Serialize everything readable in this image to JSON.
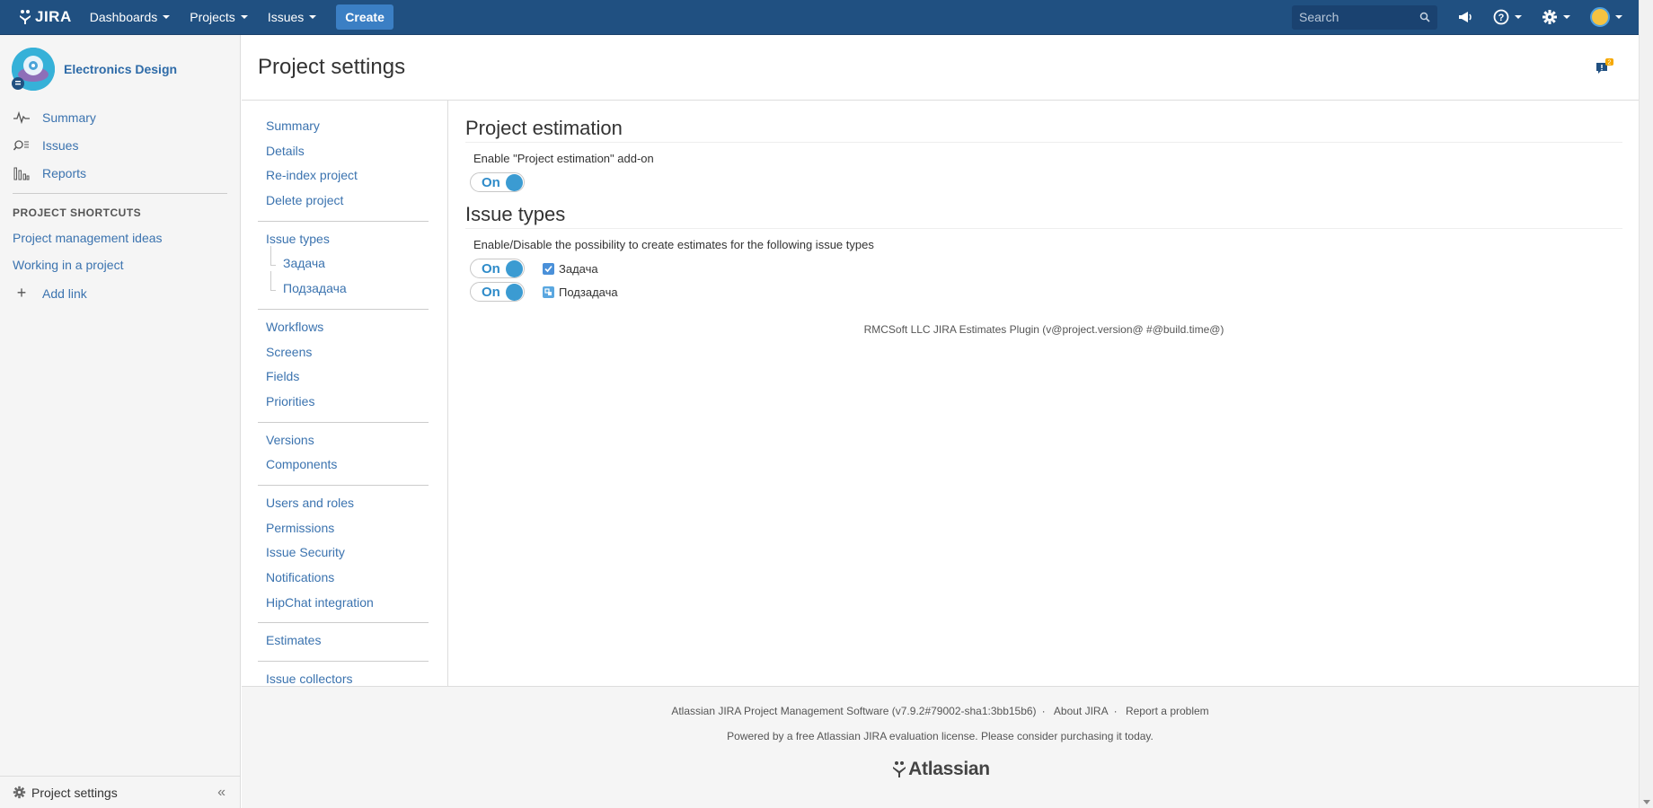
{
  "topbar": {
    "logo_text": "JIRA",
    "nav": [
      {
        "label": "Dashboards"
      },
      {
        "label": "Projects"
      },
      {
        "label": "Issues"
      }
    ],
    "create_label": "Create",
    "search_placeholder": "Search"
  },
  "sidebar": {
    "project_name": "Electronics Design",
    "items": [
      {
        "label": "Summary",
        "icon": "pulse-icon"
      },
      {
        "label": "Issues",
        "icon": "issues-search-icon"
      },
      {
        "label": "Reports",
        "icon": "bar-chart-icon"
      }
    ],
    "shortcuts_heading": "PROJECT SHORTCUTS",
    "shortcuts": [
      {
        "label": "Project management ideas"
      },
      {
        "label": "Working in a project"
      }
    ],
    "add_link_label": "Add link",
    "bottom_label": "Project settings",
    "collapse_symbol": "«"
  },
  "header": {
    "title": "Project settings",
    "feedback_count": "2"
  },
  "subnav": {
    "group1": [
      "Summary",
      "Details",
      "Re-index project",
      "Delete project"
    ],
    "group2_parent": "Issue types",
    "group2_children": [
      "Задача",
      "Подзадача"
    ],
    "group3": [
      "Workflows",
      "Screens",
      "Fields",
      "Priorities"
    ],
    "group4": [
      "Versions",
      "Components"
    ],
    "group5": [
      "Users and roles",
      "Permissions",
      "Issue Security",
      "Notifications",
      "HipChat integration"
    ],
    "group6": [
      "Estimates"
    ],
    "group7": [
      "Issue collectors"
    ]
  },
  "content": {
    "estimation_title": "Project estimation",
    "estimation_desc": "Enable \"Project estimation\" add-on",
    "toggle_label": "On",
    "issue_types_title": "Issue types",
    "issue_types_desc": "Enable/Disable the possibility to create estimates for the following issue types",
    "issue_types": [
      {
        "name": "Задача",
        "state": "On"
      },
      {
        "name": "Подзадача",
        "state": "On"
      }
    ],
    "plugin_note": "RMCSoft LLC JIRA Estimates Plugin (v@project.version@ #@build.time@)"
  },
  "footer": {
    "software": "Atlassian JIRA Project Management Software (v7.9.2#79002-sha1:3bb15b6)",
    "about": "About JIRA",
    "report": "Report a problem",
    "license": "Powered by a free Atlassian JIRA evaluation license. Please consider purchasing it today.",
    "brand": "Atlassian"
  },
  "colors": {
    "topbar": "#205081",
    "link": "#3b73af",
    "toggle_knob": "#3b9bd2"
  }
}
